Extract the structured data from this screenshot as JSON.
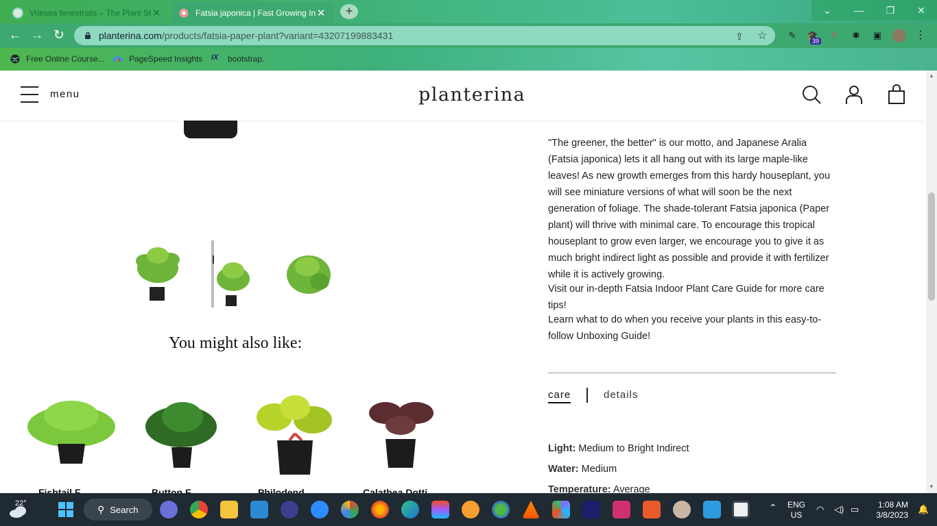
{
  "browser": {
    "tabs": [
      {
        "title": "Vriesea fenestralis – The Plant Sto",
        "active": false
      },
      {
        "title": "Fatsia japonica | Fast Growing Ind",
        "active": true
      }
    ],
    "new_tab": "+",
    "url_host": "planterina.com",
    "url_path": "/products/fatsia-paper-plant?variant=43207199883431",
    "extension_badge": "39",
    "bookmarks": [
      "Free Online Course...",
      "PageSpeed Insights",
      "bootstrap."
    ],
    "window_controls": [
      "⌄",
      "—",
      "❐",
      "✕"
    ]
  },
  "site": {
    "menu_label": "menu",
    "logo": "planterina"
  },
  "product": {
    "description": [
      "\"The greener, the better\" is our motto, and Japanese Aralia (Fatsia japonica) lets it all hang out with its large maple-like leaves! As new growth emerges from this hardy houseplant, you will see miniature versions of what will soon be the next generation of foliage. The shade-tolerant Fatsia japonica (Paper plant) will thrive with minimal care. To encourage this tropical houseplant to grow even larger, we encourage you to give it as much bright indirect light as possible and provide it with fertilizer while it is actively growing.",
      "Visit our in-depth Fatsia Indoor Plant Care Guide for more care tips!",
      "Learn what to do when you receive your plants in this easy-to-follow Unboxing Guide!"
    ],
    "info_tabs": {
      "care": "care",
      "details": "details"
    },
    "attributes": [
      {
        "label": "Light:",
        "value": "Medium to Bright Indirect"
      },
      {
        "label": "Water:",
        "value": "Medium"
      },
      {
        "label": "Temperature:",
        "value": "Average"
      }
    ]
  },
  "recommendations": {
    "heading": "You might also like:",
    "items": [
      "Fishtail F",
      "Button F",
      "Philodend",
      "Calathea Dotti"
    ]
  },
  "taskbar": {
    "temperature": "22°",
    "search_label": "Search",
    "language": "ENG",
    "region": "US",
    "time": "1:08 AM",
    "date": "3/8/2023"
  },
  "colors": {
    "chrome_green": "#3da86f",
    "omnibox": "#8fd9c0",
    "taskbar": "#1f2a33"
  }
}
